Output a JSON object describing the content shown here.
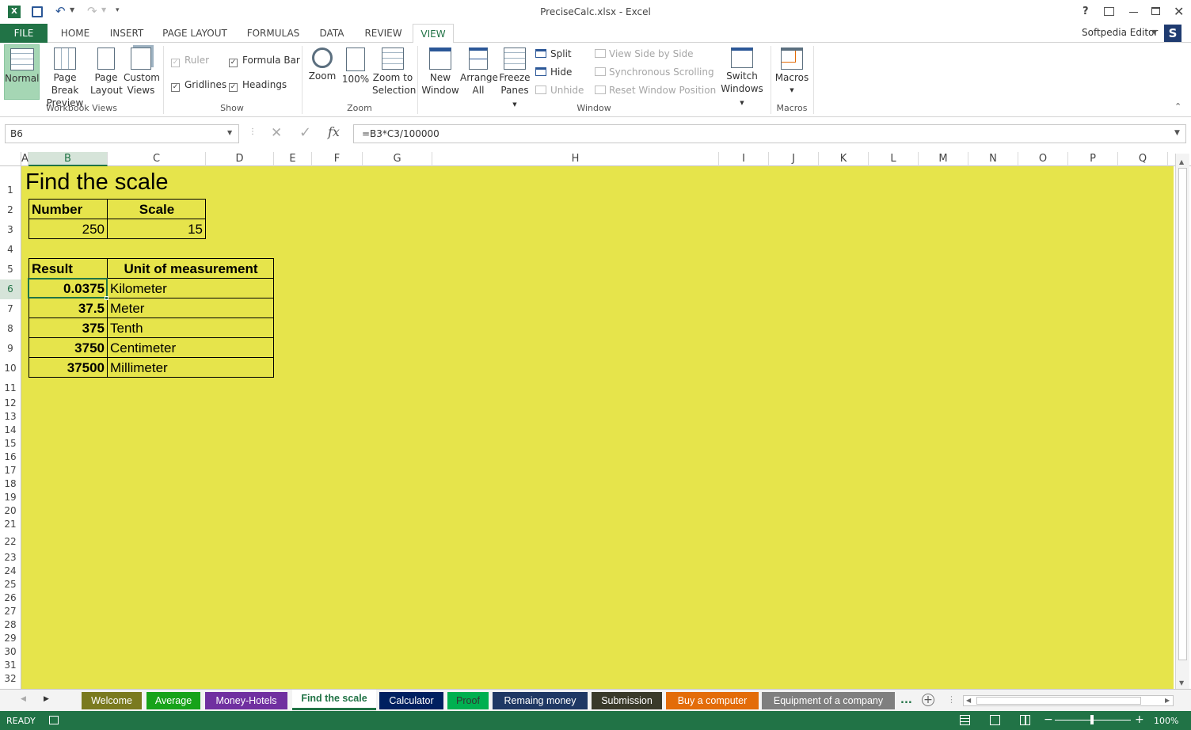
{
  "window": {
    "title": "PreciseCalc.xlsx - Excel",
    "user": "Softpedia Editor",
    "user_initial": "S"
  },
  "ribbon_tabs": [
    "FILE",
    "HOME",
    "INSERT",
    "PAGE LAYOUT",
    "FORMULAS",
    "DATA",
    "REVIEW",
    "VIEW"
  ],
  "active_tab": "VIEW",
  "groups": {
    "workbook_views": {
      "label": "Workbook Views",
      "normal": "Normal",
      "page_break_1": "Page Break",
      "page_break_2": "Preview",
      "page_layout_1": "Page",
      "page_layout_2": "Layout",
      "custom_1": "Custom",
      "custom_2": "Views"
    },
    "show": {
      "label": "Show",
      "ruler": "Ruler",
      "formula_bar": "Formula Bar",
      "gridlines": "Gridlines",
      "headings": "Headings"
    },
    "zoom": {
      "label": "Zoom",
      "zoom": "Zoom",
      "zoom100": "100%",
      "zoom_sel_1": "Zoom to",
      "zoom_sel_2": "Selection"
    },
    "window": {
      "label": "Window",
      "new_1": "New",
      "new_2": "Window",
      "arrange_1": "Arrange",
      "arrange_2": "All",
      "freeze_1": "Freeze",
      "freeze_2": "Panes",
      "split": "Split",
      "hide": "Hide",
      "unhide": "Unhide",
      "side_by_side": "View Side by Side",
      "sync": "Synchronous Scrolling",
      "reset": "Reset Window Position",
      "switch_1": "Switch",
      "switch_2": "Windows"
    },
    "macros": {
      "label": "Macros",
      "macros": "Macros"
    }
  },
  "formula_bar": {
    "name_box": "B6",
    "fx": "fx",
    "formula": "=B3*C3/100000"
  },
  "columns": [
    "A",
    "B",
    "C",
    "D",
    "E",
    "F",
    "G",
    "H",
    "I",
    "J",
    "K",
    "L",
    "M",
    "N",
    "O",
    "P",
    "Q"
  ],
  "rows": [
    "1",
    "2",
    "3",
    "4",
    "5",
    "6",
    "7",
    "8",
    "9",
    "10",
    "11",
    "12",
    "13",
    "14",
    "15",
    "16",
    "17",
    "18",
    "19",
    "20",
    "21",
    "22",
    "23",
    "24",
    "25",
    "26",
    "27",
    "28",
    "29",
    "30",
    "31",
    "32"
  ],
  "sheet": {
    "title": "Find the scale",
    "input_headers": [
      "Number",
      "Scale"
    ],
    "input_values": [
      "250",
      "15"
    ],
    "result_headers": [
      "Result",
      "Unit of measurement"
    ],
    "results": [
      {
        "value": "0.0375",
        "unit": "Kilometer"
      },
      {
        "value": "37.5",
        "unit": "Meter"
      },
      {
        "value": "375",
        "unit": "Tenth"
      },
      {
        "value": "3750",
        "unit": "Centimeter"
      },
      {
        "value": "37500",
        "unit": "Millimeter"
      }
    ]
  },
  "sheet_tabs": [
    {
      "label": "Welcome",
      "color": "#7a7a1f"
    },
    {
      "label": "Average",
      "color": "#17a31a"
    },
    {
      "label": "Money-Hotels",
      "color": "#7030a0"
    },
    {
      "label": "Find the scale",
      "color": "#ffffff"
    },
    {
      "label": "Calculator",
      "color": "#002060"
    },
    {
      "label": "Proof",
      "color": "#00b050"
    },
    {
      "label": "Remaing money",
      "color": "#1f3864"
    },
    {
      "label": "Submission",
      "color": "#3a3a2a"
    },
    {
      "label": "Buy a computer",
      "color": "#e36c09"
    },
    {
      "label": "Equipment of a company",
      "color": "#7f7f7f"
    }
  ],
  "sheet_tabs_more": "...",
  "status": {
    "state": "READY",
    "zoom": "100%"
  }
}
